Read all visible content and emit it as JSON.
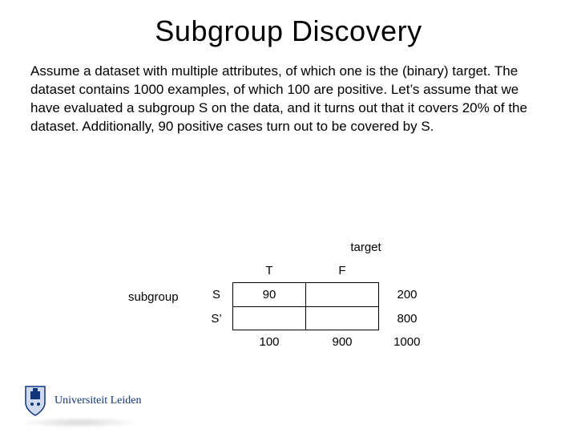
{
  "title": "Subgroup Discovery",
  "paragraph": "Assume a dataset with multiple attributes, of which one is the (binary) target. The dataset contains 1000 examples, of which 100 are positive. Let’s assume that we have evaluated a subgroup S on the data, and it turns out that it covers 20% of the dataset. Additionally, 90 positive cases turn out to be covered by S.",
  "table": {
    "top_label": "target",
    "side_label": "subgroup",
    "col_headers": {
      "t": "T",
      "f": "F"
    },
    "row_headers": {
      "s": "S",
      "sc": "S’"
    },
    "cells": {
      "s_t": "90",
      "s_f": "",
      "sc_t": "",
      "sc_f": ""
    },
    "row_totals": {
      "s": "200",
      "sc": "800"
    },
    "col_totals": {
      "t": "100",
      "f": "900"
    },
    "grand_total": "1000"
  },
  "footer": {
    "institution": "Universiteit Leiden"
  }
}
